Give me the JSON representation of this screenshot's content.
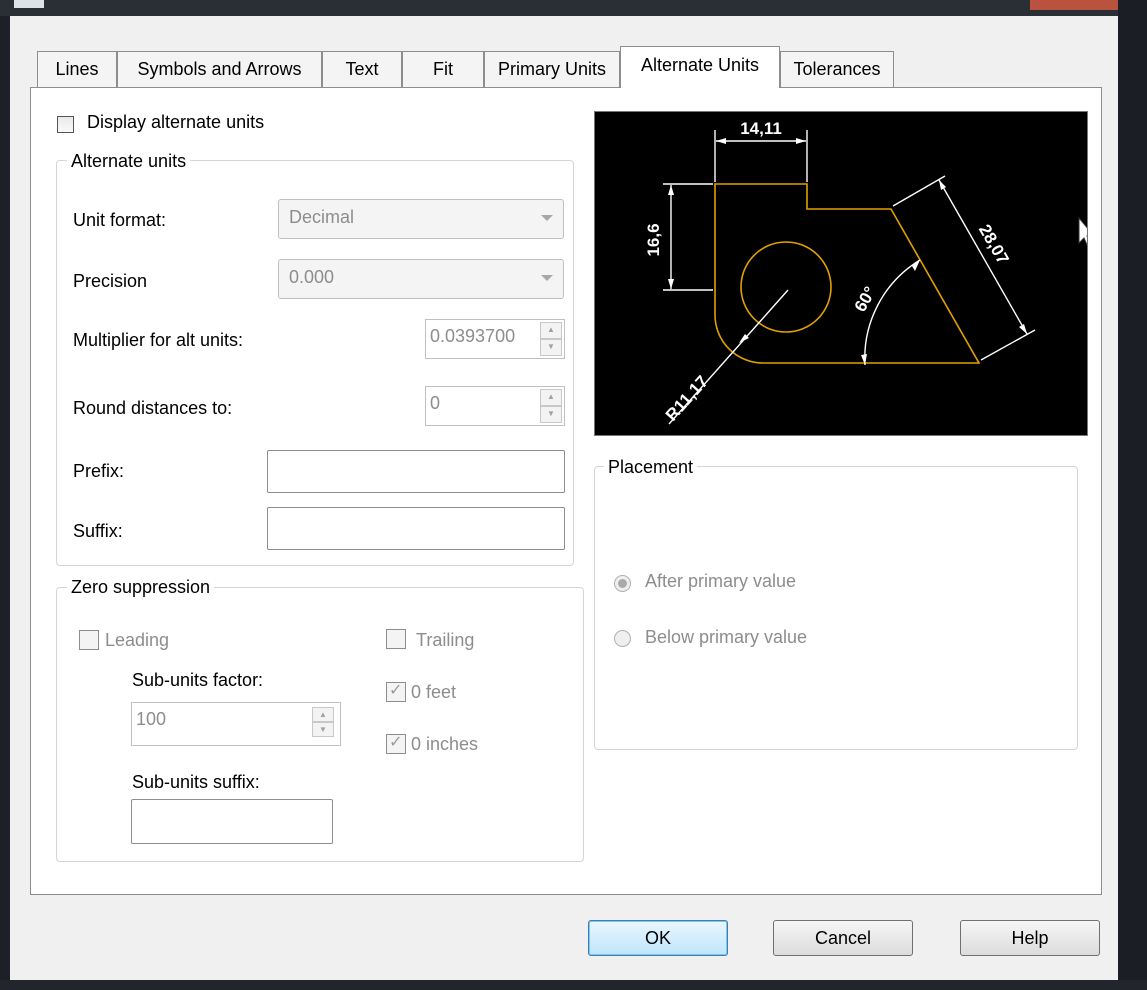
{
  "tabs": [
    {
      "label": "Lines",
      "active": false
    },
    {
      "label": "Symbols and Arrows",
      "active": false
    },
    {
      "label": "Text",
      "active": false
    },
    {
      "label": "Fit",
      "active": false
    },
    {
      "label": "Primary Units",
      "active": false
    },
    {
      "label": "Alternate Units",
      "active": true
    },
    {
      "label": "Tolerances",
      "active": false
    }
  ],
  "display_alt_units": {
    "label": "Display alternate units",
    "checked": false
  },
  "alt_units": {
    "legend": "Alternate units",
    "unit_format_label": "Unit format:",
    "unit_format_value": "Decimal",
    "precision_label": "Precision",
    "precision_value": "0.000",
    "multiplier_label": "Multiplier for alt units:",
    "multiplier_value": "0.0393700",
    "round_label": "Round distances  to:",
    "round_value": "0",
    "prefix_label": "Prefix:",
    "prefix_value": "",
    "suffix_label": "Suffix:",
    "suffix_value": ""
  },
  "zero_suppression": {
    "legend": "Zero suppression",
    "leading_label": "Leading",
    "leading_checked": false,
    "trailing_label": "Trailing",
    "trailing_checked": false,
    "subunits_factor_label": "Sub-units factor:",
    "subunits_factor_value": "100",
    "feet_label": "0 feet",
    "feet_checked": true,
    "inches_label": "0 inches",
    "inches_checked": true,
    "subunits_suffix_label": "Sub-units suffix:",
    "subunits_suffix_value": ""
  },
  "preview": {
    "dim_top": "14,11",
    "dim_left": "16,6",
    "dim_right": "28,07",
    "dim_angle": "60°",
    "dim_radius": "R11,17",
    "background_color": "#000000",
    "geometry_color": "#e0a000",
    "dimension_color": "#ffffff"
  },
  "placement": {
    "legend": "Placement",
    "options": [
      {
        "label": "After primary value",
        "selected": true
      },
      {
        "label": "Below primary value",
        "selected": false
      }
    ]
  },
  "buttons": {
    "ok": "OK",
    "cancel": "Cancel",
    "help": "Help"
  }
}
